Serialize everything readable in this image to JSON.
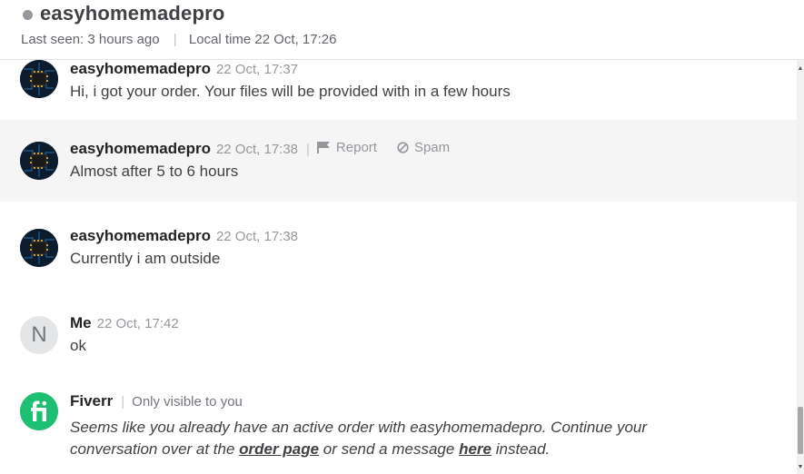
{
  "header": {
    "contact_name": "easyhomemadepro",
    "last_seen_label": "Last seen:",
    "last_seen_value": "3 hours ago",
    "local_time": "Local time 22 Oct, 17:26"
  },
  "messages": [
    {
      "sender": "easyhomemadepro",
      "time": "22 Oct, 17:37",
      "text": "Hi, i got your order. Your files will be provided with in a few hours"
    },
    {
      "sender": "easyhomemadepro",
      "time": "22 Oct, 17:38",
      "text": "Almost after 5 to 6 hours",
      "actions": {
        "report": "Report",
        "spam": "Spam"
      }
    },
    {
      "sender": "easyhomemadepro",
      "time": "22 Oct, 17:38",
      "text": "Currently i am outside"
    },
    {
      "sender": "Me",
      "avatar_initial": "N",
      "time": "22 Oct, 17:42",
      "text": "ok"
    }
  ],
  "system": {
    "sender": "Fiverr",
    "visibility": "Only visible to you",
    "text_before": "Seems like you already have an active order with easyhomemadepro. Continue your conversation over at the ",
    "order_link": "order page",
    "text_middle": " or send a message ",
    "here_link": "here",
    "text_after": " instead."
  },
  "icons": {
    "status": "status-dot-icon",
    "report": "flag-icon",
    "spam": "ban-icon",
    "fiverr": "fiverr-logo-icon"
  },
  "colors": {
    "fiverr_green": "#1dbf73",
    "highlight_row": "#f5f5f5",
    "muted_text": "#95979d"
  }
}
